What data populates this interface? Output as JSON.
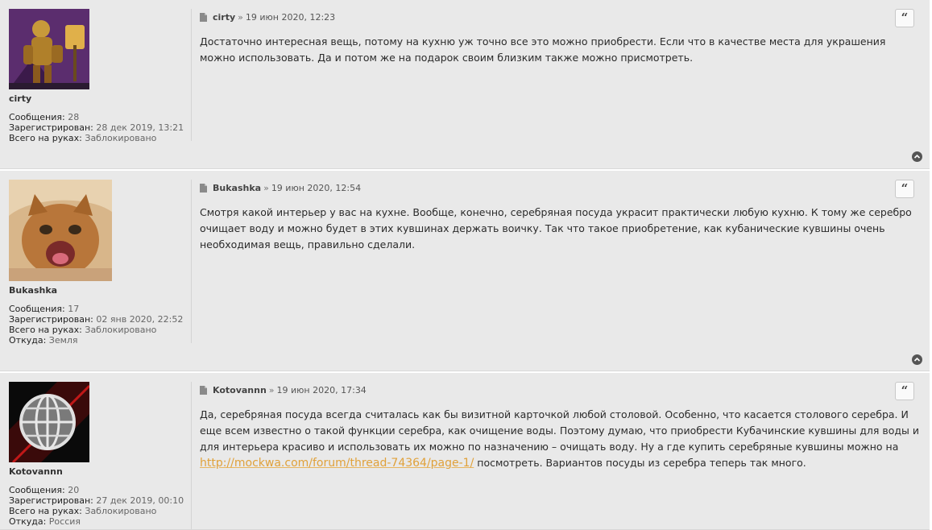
{
  "stat_labels": {
    "posts": "Сообщения:",
    "registered": "Зарегистрирован:",
    "in_hand": "Всего на руках:",
    "from": "Откуда:"
  },
  "icons": {
    "post_link": "file-icon",
    "quote": "quote-icon",
    "top": "arrow-up-icon"
  },
  "posts": [
    {
      "username": "cirty",
      "posts": "28",
      "registered": "28 дек 2019, 13:21",
      "in_hand": "Заблокировано",
      "author": "cirty",
      "sep": "»",
      "time": "19 июн 2020, 12:23",
      "text": "Достаточно интересная вещь, потому на кухню уж точно все это можно приобрести. Если что в качестве места для украшения можно использовать. Да и потом же на подарок своим близким также можно присмотреть."
    },
    {
      "username": "Bukashka",
      "posts": "17",
      "registered": "02 янв 2020, 22:52",
      "in_hand": "Заблокировано",
      "from": "Земля",
      "author": "Bukashka",
      "sep": "»",
      "time": "19 июн 2020, 12:54",
      "text": "Смотря какой интерьер у вас на кухне. Вообще, конечно, серебряная посуда украсит практически любую кухню. К тому же серебро очищает воду и можно будет в этих кувшинах держать воичку. Так что такое приобретение, как кубанические кувшины очень необходимая вещь, правильно сделали."
    },
    {
      "username": "Kotovannn",
      "posts": "20",
      "registered": "27 дек 2019, 00:10",
      "in_hand": "Заблокировано",
      "from": "Россия",
      "author": "Kotovannn",
      "sep": "»",
      "time": "19 июн 2020, 17:34",
      "text_before": "Да, серебряная посуда всегда считалась как бы визитной карточкой любой столовой. Особенно, что касается столового серебра. И еще всем известно о такой функции серебра, как очищение воды. Поэтому думаю, что приобрести Кубачинские кувшины для воды и для интерьера красиво и использовать их можно по назначению – очищать воду. Ну а где купить серебряные кувшины можно на",
      "link": "http://mockwa.com/forum/thread-74364/page-1/",
      "text_after": " посмотреть. Вариантов посуды из серебра теперь так много."
    }
  ]
}
